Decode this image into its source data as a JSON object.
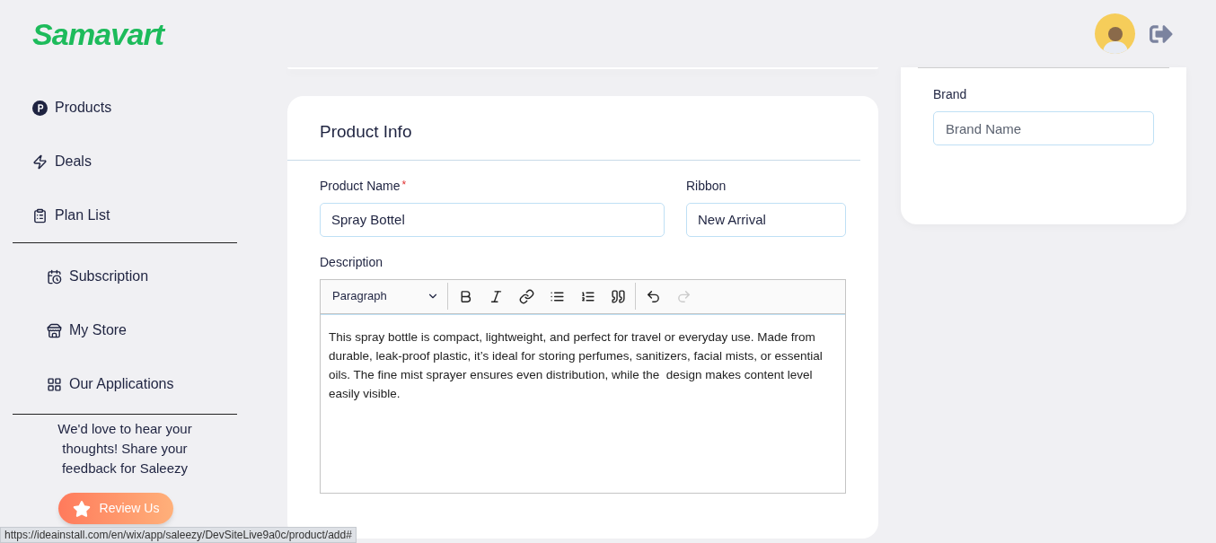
{
  "header": {
    "logo": "Samavart"
  },
  "sidebar": {
    "groups": [
      {
        "items": [
          {
            "label": "Products"
          },
          {
            "label": "Deals"
          },
          {
            "label": "Plan List"
          }
        ]
      },
      {
        "items": [
          {
            "label": "Subscription"
          },
          {
            "label": "My Store"
          },
          {
            "label": "Our Applications"
          }
        ]
      }
    ],
    "feedback": "We'd love to hear your thoughts! Share your feedback for Saleezy",
    "review_button": "Review Us"
  },
  "product_info": {
    "title": "Product Info",
    "product_name": {
      "label": "Product Name",
      "required_mark": "*",
      "value": "Spray Bottel"
    },
    "ribbon": {
      "label": "Ribbon",
      "value": "New Arrival"
    },
    "description": {
      "label": "Description",
      "block_format": "Paragraph",
      "tool_groups": [
        [
          {
            "kind": "bold",
            "disabled": false
          },
          {
            "kind": "italic",
            "disabled": false
          },
          {
            "kind": "link",
            "disabled": false
          },
          {
            "kind": "bullets",
            "disabled": false
          },
          {
            "kind": "numbers",
            "disabled": false
          },
          {
            "kind": "quote",
            "disabled": false
          }
        ],
        [
          {
            "kind": "undo",
            "disabled": false
          },
          {
            "kind": "redo",
            "disabled": true
          }
        ]
      ],
      "text": "This spray bottle is compact, lightweight, and perfect for travel or everyday use. Made from durable, leak-proof plastic, it’s ideal for storing perfumes, sanitizers, facial mists, or essential oils. The fine mist sprayer ensures even distribution, while the  design makes content level easily visible."
    }
  },
  "brand": {
    "label": "Brand",
    "placeholder": "Brand Name"
  },
  "status_bar": {
    "url": "https://ideainstall.com/en/wix/app/saleezy/DevSiteLive9a0c/product/add#"
  }
}
